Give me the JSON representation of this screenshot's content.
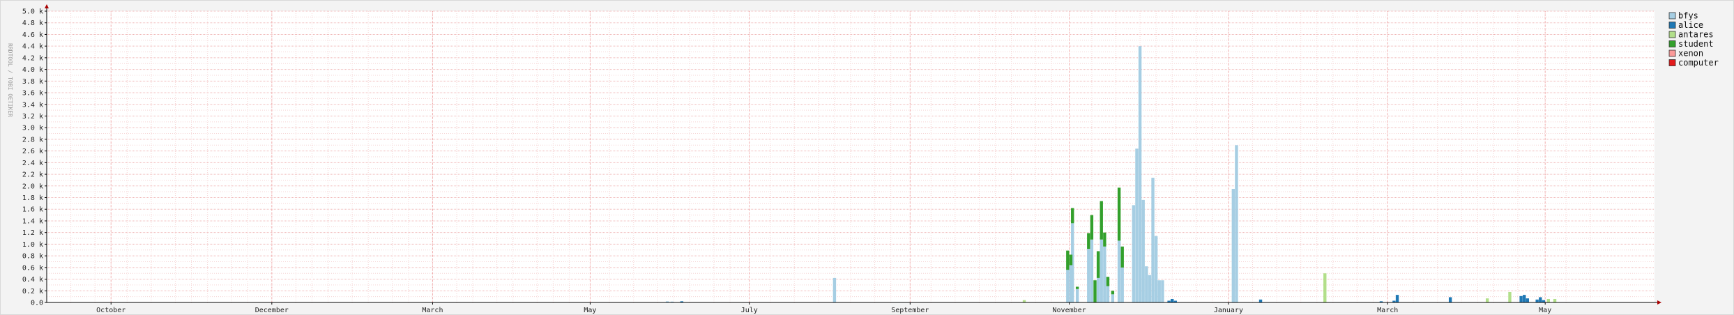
{
  "chart_data": {
    "type": "bar",
    "stacked": true,
    "ylabel": "RRDTOOL / TOBI OETIKER",
    "ylim": [
      0,
      5000
    ],
    "yticks": [
      "0.0",
      "0.2 k",
      "0.4 k",
      "0.6 k",
      "0.8 k",
      "1.0 k",
      "1.2 k",
      "1.4 k",
      "1.6 k",
      "1.8 k",
      "2.0 k",
      "2.2 k",
      "2.4 k",
      "2.6 k",
      "2.8 k",
      "3.0 k",
      "3.2 k",
      "3.4 k",
      "3.6 k",
      "3.8 k",
      "4.0 k",
      "4.2 k",
      "4.4 k",
      "4.6 k",
      "4.8 k",
      "5.0 k"
    ],
    "ytick_values": [
      0,
      200,
      400,
      600,
      800,
      1000,
      1200,
      1400,
      1600,
      1800,
      2000,
      2200,
      2400,
      2600,
      2800,
      3000,
      3200,
      3400,
      3600,
      3800,
      4000,
      4200,
      4400,
      4600,
      4800,
      5000
    ],
    "xrange": [
      0,
      1000
    ],
    "month_labels": [
      {
        "label": "October",
        "x": 40
      },
      {
        "label": "December",
        "x": 140
      },
      {
        "label": "March",
        "x": 240
      },
      {
        "label": "May",
        "x": 338
      },
      {
        "label": "July",
        "x": 437
      },
      {
        "label": "September",
        "x": 537
      },
      {
        "label": "November",
        "x": 636
      },
      {
        "label": "January",
        "x": 735
      },
      {
        "label": "March",
        "x": 834
      },
      {
        "label": "May",
        "x": 932
      }
    ],
    "week_lines": [
      0,
      15,
      30,
      40,
      50,
      65,
      80,
      90,
      100,
      115,
      125,
      140,
      155,
      165,
      175,
      190,
      200,
      215,
      225,
      240,
      255,
      265,
      280,
      290,
      305,
      315,
      325,
      338,
      350,
      365,
      380,
      390,
      400,
      415,
      425,
      437,
      450,
      465,
      480,
      490,
      500,
      515,
      525,
      537,
      550,
      565,
      580,
      590,
      600,
      615,
      625,
      636,
      650,
      665,
      680,
      690,
      700,
      715,
      725,
      735,
      750,
      765,
      780,
      790,
      800,
      815,
      825,
      834,
      850,
      865,
      880,
      890,
      900,
      915,
      932,
      945,
      960
    ],
    "series": [
      {
        "name": "bfys",
        "color": "#a6cee3",
        "points": [
          [
            386,
            20
          ],
          [
            389,
            15
          ],
          [
            490,
            420
          ],
          [
            635,
            560
          ],
          [
            637,
            640
          ],
          [
            638,
            1360
          ],
          [
            641,
            230
          ],
          [
            648,
            920
          ],
          [
            650,
            1080
          ],
          [
            654,
            420
          ],
          [
            656,
            1080
          ],
          [
            658,
            960
          ],
          [
            660,
            280
          ],
          [
            663,
            140
          ],
          [
            667,
            1060
          ],
          [
            669,
            600
          ],
          [
            676,
            1670
          ],
          [
            678,
            2640
          ],
          [
            680,
            4400
          ],
          [
            682,
            1760
          ],
          [
            684,
            620
          ],
          [
            686,
            470
          ],
          [
            688,
            2140
          ],
          [
            690,
            1140
          ],
          [
            692,
            380
          ],
          [
            694,
            380
          ],
          [
            738,
            1950
          ],
          [
            740,
            2700
          ]
        ]
      },
      {
        "name": "alice",
        "color": "#1f78b4",
        "points": [
          [
            395,
            20
          ],
          [
            698,
            30
          ],
          [
            700,
            60
          ],
          [
            702,
            30
          ],
          [
            755,
            50
          ],
          [
            830,
            20
          ],
          [
            838,
            30
          ],
          [
            840,
            130
          ],
          [
            873,
            90
          ],
          [
            917,
            110
          ],
          [
            919,
            130
          ],
          [
            921,
            70
          ],
          [
            927,
            50
          ],
          [
            929,
            90
          ],
          [
            931,
            40
          ]
        ]
      },
      {
        "name": "antares",
        "color": "#b2df8a",
        "points": [
          [
            608,
            40
          ],
          [
            795,
            500
          ],
          [
            896,
            70
          ],
          [
            910,
            180
          ],
          [
            934,
            60
          ],
          [
            938,
            60
          ]
        ]
      },
      {
        "name": "student",
        "color": "#33a02c",
        "points": [
          [
            635,
            330
          ],
          [
            637,
            180
          ],
          [
            638,
            260
          ],
          [
            641,
            40
          ],
          [
            648,
            270
          ],
          [
            650,
            420
          ],
          [
            652,
            380
          ],
          [
            654,
            460
          ],
          [
            656,
            660
          ],
          [
            658,
            240
          ],
          [
            660,
            160
          ],
          [
            663,
            60
          ],
          [
            667,
            910
          ],
          [
            669,
            360
          ]
        ]
      },
      {
        "name": "xenon",
        "color": "#fb9a99",
        "points": []
      },
      {
        "name": "computer",
        "color": "#e31a1c",
        "points": []
      }
    ]
  }
}
